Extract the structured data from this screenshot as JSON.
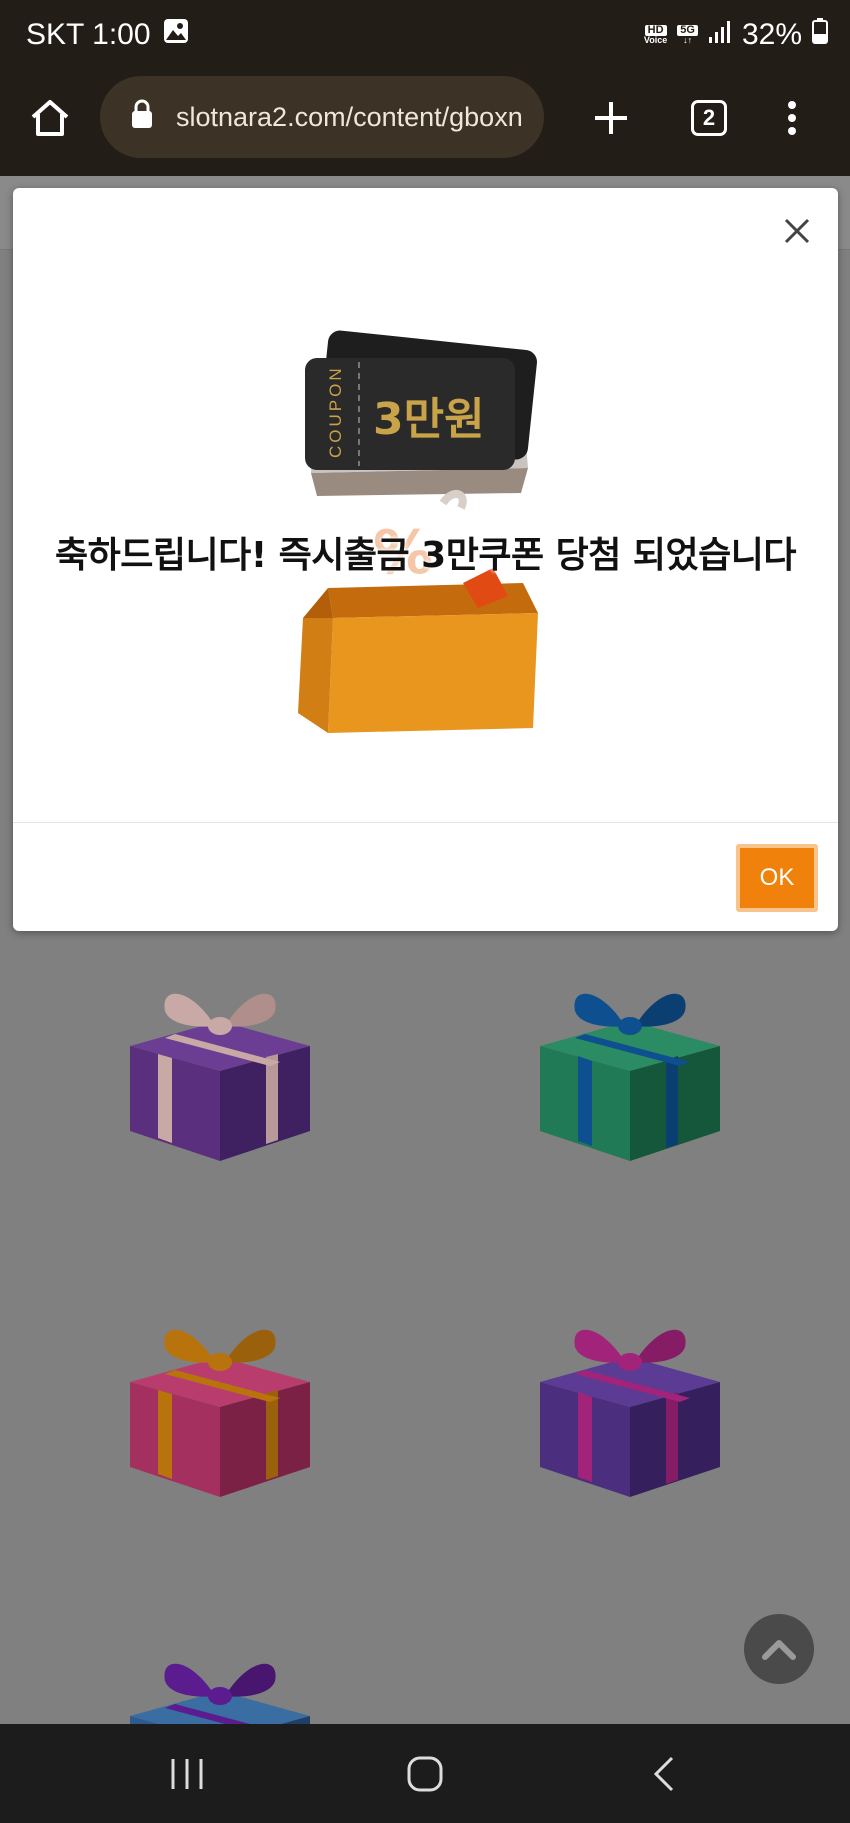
{
  "status_bar": {
    "carrier_time": "SKT 1:00",
    "hd_badge_top": "HD",
    "hd_badge_bottom": "Voice",
    "network_badge": "5G",
    "battery": "32%"
  },
  "browser": {
    "url": "slotnara2.com/content/gboxn",
    "tab_count": "2"
  },
  "modal": {
    "message": "축하드립니다! 즉시출금 3만쿠폰 당첨 되었습니다",
    "coupon_side_text": "COUPON",
    "coupon_amount": "3만원",
    "ok_label": "OK"
  },
  "gifts": [
    {
      "box": "#5a2f7e",
      "ribbon": "#c9a9a6",
      "name": "gift-box-purple"
    },
    {
      "box": "#1f7a55",
      "ribbon": "#0e4f8f",
      "name": "gift-box-green"
    },
    {
      "box": "#a3305e",
      "ribbon": "#b8730d",
      "name": "gift-box-pink"
    },
    {
      "box": "#4b2f7e",
      "ribbon": "#a1247a",
      "name": "gift-box-violet"
    },
    {
      "box": "#2e5b8e",
      "ribbon": "#5a1c8e",
      "name": "gift-box-blue"
    }
  ],
  "colors": {
    "accent": "#f0810a",
    "status_bar_bg": "#231d17",
    "overlay_bg": "#808080"
  }
}
